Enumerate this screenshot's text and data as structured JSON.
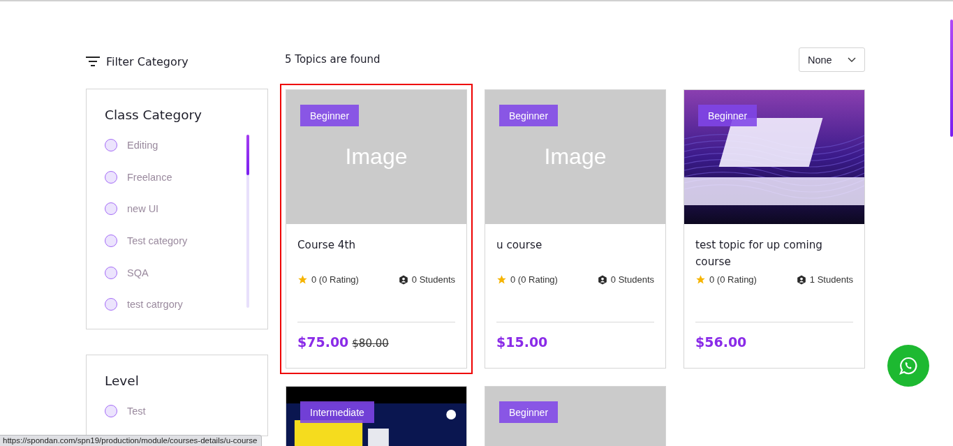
{
  "filter_heading": "Filter Category",
  "results_count": "5 Topics are found",
  "sort_select": {
    "value": "None"
  },
  "filter_groups": [
    {
      "title": "Class Category",
      "scrollable": true,
      "options": [
        {
          "label": "Editing",
          "checked": false
        },
        {
          "label": "Freelance",
          "checked": false
        },
        {
          "label": "new UI",
          "checked": false
        },
        {
          "label": "Test category",
          "checked": false
        },
        {
          "label": "SQA",
          "checked": false
        },
        {
          "label": "test catrgory",
          "checked": false
        }
      ]
    },
    {
      "title": "Level",
      "scrollable": false,
      "options": [
        {
          "label": "Test",
          "checked": false
        }
      ]
    }
  ],
  "courses": [
    {
      "level": "Beginner",
      "image": {
        "kind": "placeholder",
        "text": "Image"
      },
      "title": "Course 4th",
      "rating": "0 (0 Rating)",
      "students": "0 Students",
      "price": "$75.00",
      "old_price": "$80.00",
      "selected": true
    },
    {
      "level": "Beginner",
      "image": {
        "kind": "placeholder",
        "text": "Image"
      },
      "title": "u course",
      "rating": "0 (0 Rating)",
      "students": "0 Students",
      "price": "$15.00",
      "selected": false
    },
    {
      "level": "Beginner",
      "title": "test topic for up coming course",
      "rating": "0 (0 Rating)",
      "students": "1 Students",
      "price": "$56.00",
      "selected": false
    },
    {
      "level": "Intermediate",
      "selected": false
    },
    {
      "level": "Beginner",
      "image": {
        "kind": "placeholder"
      },
      "selected": false
    }
  ],
  "status_url": "https://spondan.com/spn19/production/module/courses-details/u-course"
}
